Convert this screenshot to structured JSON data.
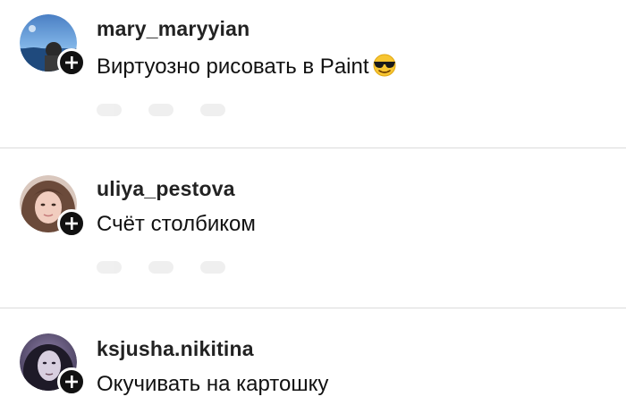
{
  "comments": [
    {
      "username": "mary_maryyian",
      "text": "Виртуозно рисовать в Paint",
      "emoji": "smiling-face-with-sunglasses-icon"
    },
    {
      "username": "uliya_pestova",
      "text": "Счёт столбиком"
    },
    {
      "username": "ksjusha.nikitina",
      "text": "Окучивать на картошку"
    }
  ],
  "colors": {
    "divider": "#dbdbdb",
    "text": "#111111",
    "badge": "#111111"
  }
}
